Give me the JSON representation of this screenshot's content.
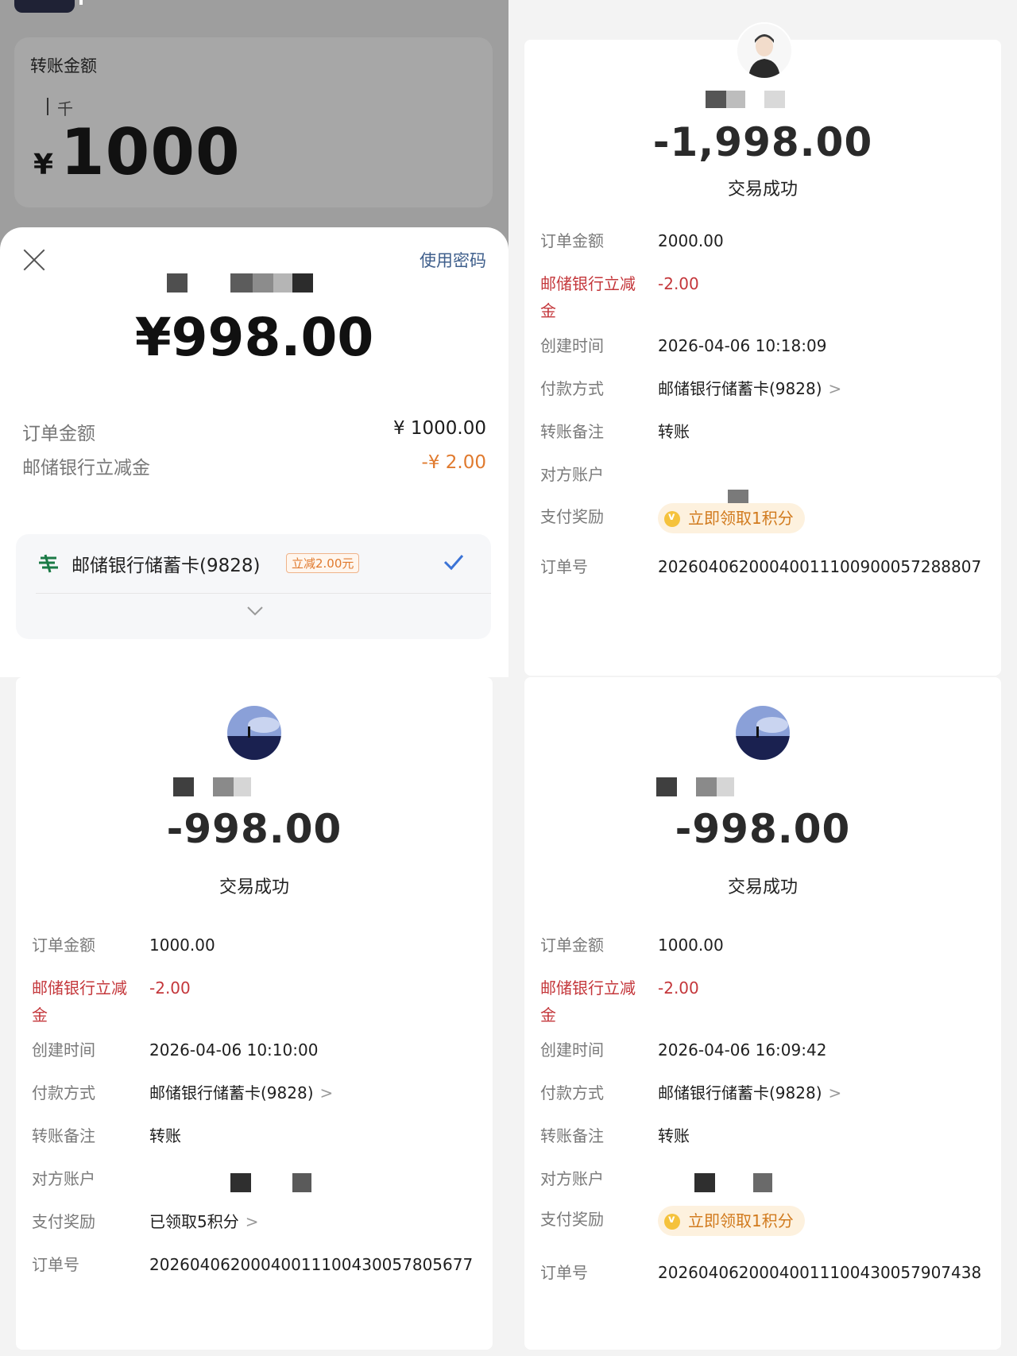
{
  "transfer": {
    "amount_title": "转账金额",
    "unit_hint": "千",
    "currency": "¥",
    "amount": "1000"
  },
  "pay_sheet": {
    "use_password": "使用密码",
    "amount": "¥998.00",
    "order_amount_label": "订单金额",
    "order_amount_value": "¥ 1000.00",
    "discount_label": "邮储银行立减金",
    "discount_value": "-¥ 2.00",
    "card_name": "邮储银行储蓄卡(9828)",
    "card_tag": "立减2.00元",
    "accent": "#3b73d6"
  },
  "receipts": [
    {
      "amount": "-1,998.00",
      "status": "交易成功",
      "order_amount_label": "订单金额",
      "order_amount": "2000.00",
      "discount_label": "邮储银行立减金",
      "discount": "-2.00",
      "created_label": "创建时间",
      "created": "2026-04-06 10:18:09",
      "pay_method_label": "付款方式",
      "pay_method": "邮储银行储蓄卡(9828)",
      "memo_label": "转账备注",
      "memo": "转账",
      "counterparty_label": "对方账户",
      "reward_label": "支付奖励",
      "reward": "立即领取1积分",
      "order_no_label": "订单号",
      "order_no": "20260406200040011100900057288807"
    },
    {
      "amount": "-998.00",
      "status": "交易成功",
      "order_amount_label": "订单金额",
      "order_amount": "1000.00",
      "discount_label": "邮储银行立减金",
      "discount": "-2.00",
      "created_label": "创建时间",
      "created": "2026-04-06 10:10:00",
      "pay_method_label": "付款方式",
      "pay_method": "邮储银行储蓄卡(9828)",
      "memo_label": "转账备注",
      "memo": "转账",
      "counterparty_label": "对方账户",
      "reward_label": "支付奖励",
      "reward": "已领取5积分",
      "order_no_label": "订单号",
      "order_no": "20260406200040011100430057805677"
    },
    {
      "amount": "-998.00",
      "status": "交易成功",
      "order_amount_label": "订单金额",
      "order_amount": "1000.00",
      "discount_label": "邮储银行立减金",
      "discount": "-2.00",
      "created_label": "创建时间",
      "created": "2026-04-06 16:09:42",
      "pay_method_label": "付款方式",
      "pay_method": "邮储银行储蓄卡(9828)",
      "memo_label": "转账备注",
      "memo": "转账",
      "counterparty_label": "对方账户",
      "reward_label": "支付奖励",
      "reward": "立即领取1积分",
      "order_no_label": "订单号",
      "order_no": "20260406200040011100430057907438"
    }
  ]
}
